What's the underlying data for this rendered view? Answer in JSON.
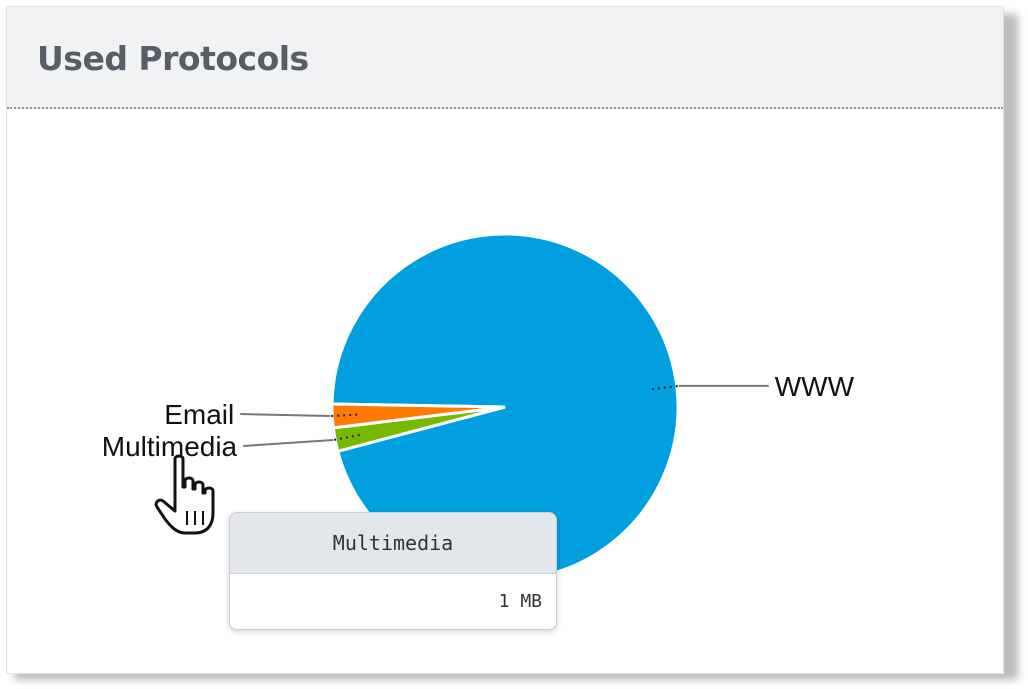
{
  "panel": {
    "title": "Used Protocols"
  },
  "chart_data": {
    "type": "pie",
    "slices": [
      {
        "label": "WWW",
        "value": 95.6,
        "color": "#00a0e0"
      },
      {
        "label": "Multimedia",
        "value": 2.2,
        "color": "#76b900"
      },
      {
        "label": "Email",
        "value": 2.2,
        "color": "#ff7a00"
      }
    ],
    "tooltip": {
      "label": "Multimedia",
      "value": "1 MB"
    }
  },
  "icons": {
    "cursor": "hand-pointer-icon"
  }
}
